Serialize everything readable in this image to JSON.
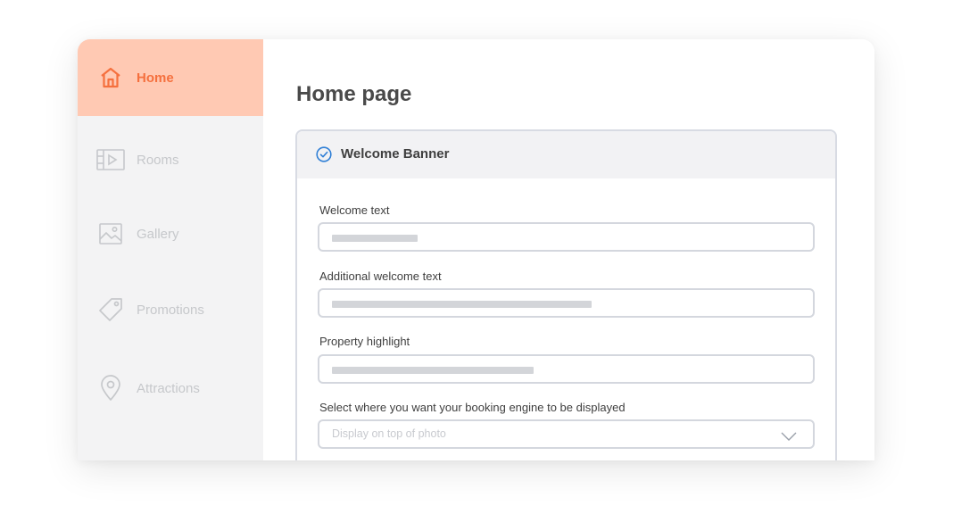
{
  "sidebar": {
    "items": [
      {
        "label": "Home",
        "icon": "home-icon",
        "active": true
      },
      {
        "label": "Rooms",
        "icon": "video-icon",
        "active": false
      },
      {
        "label": "Gallery",
        "icon": "image-icon",
        "active": false
      },
      {
        "label": "Promotions",
        "icon": "tag-icon",
        "active": false
      },
      {
        "label": "Attractions",
        "icon": "location-pin-icon",
        "active": false
      }
    ]
  },
  "main": {
    "title": "Home page",
    "panel": {
      "title": "Welcome Banner",
      "icon": "check-circle-icon",
      "fields": [
        {
          "label": "Welcome text"
        },
        {
          "label": "Additional welcome text"
        },
        {
          "label": "Property highlight"
        },
        {
          "label": "Select where you want your booking engine to be displayed",
          "value": "Display on top of photo"
        }
      ]
    }
  },
  "colors": {
    "accent": "#f5703e",
    "active_bg": "#ffc9b3",
    "sidebar_bg": "#f3f3f4",
    "check_blue": "#2f7fd6"
  }
}
